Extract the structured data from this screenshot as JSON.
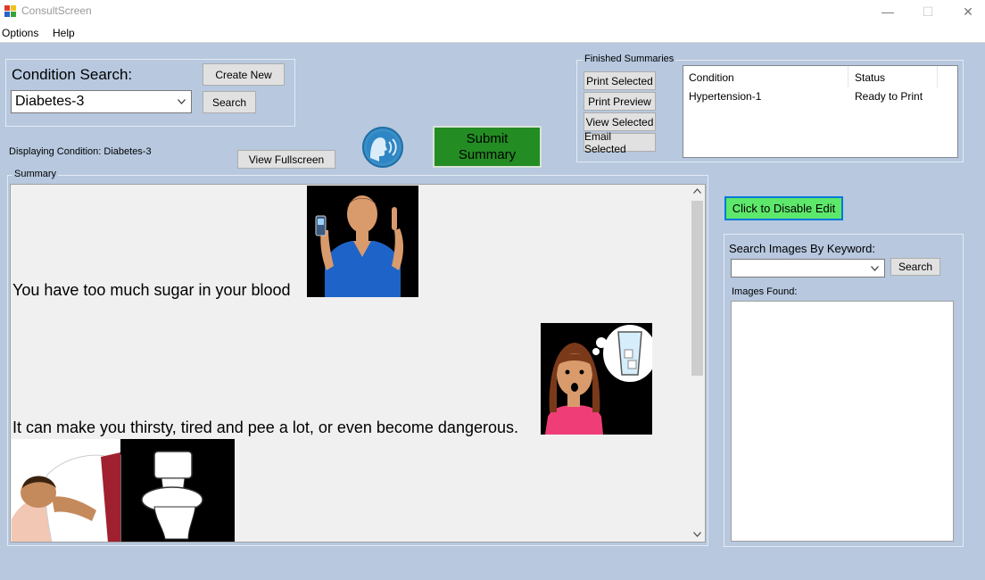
{
  "window": {
    "title": "ConsultScreen",
    "minimize": "—",
    "maximize": "☐",
    "close": "✕"
  },
  "menu": {
    "items": [
      "Options",
      "Help"
    ]
  },
  "condition_search": {
    "label": "Condition Search:",
    "selected": "Diabetes-3",
    "create_new": "Create New",
    "search": "Search"
  },
  "displaying": "Displaying Condition: Diabetes-3",
  "view_fullscreen": "View Fullscreen",
  "submit_summary_line1": "Submit",
  "submit_summary_line2": "Summary",
  "finished": {
    "title": "Finished Summaries",
    "print_selected": "Print Selected",
    "print_preview": "Print Preview",
    "view_selected": "View Selected",
    "email_selected": "Email Selected",
    "columns": [
      "Condition",
      "Status"
    ],
    "rows": [
      {
        "condition": "Hypertension-1",
        "status": "Ready to Print"
      }
    ]
  },
  "summary": {
    "title": "Summary",
    "line1": "You have too much sugar in your blood",
    "line2": "It can make you thirsty, tired and pee a lot, or even become dangerous."
  },
  "disable_edit": "Click to Disable Edit",
  "image_search": {
    "label": "Search Images By Keyword:",
    "value": "",
    "search": "Search",
    "found_label": "Images Found:"
  },
  "colors": {
    "background": "#b7c8df",
    "submit_green": "#238c23",
    "disable_edit_green": "#5ee86b",
    "disable_edit_border": "#0078d7"
  }
}
